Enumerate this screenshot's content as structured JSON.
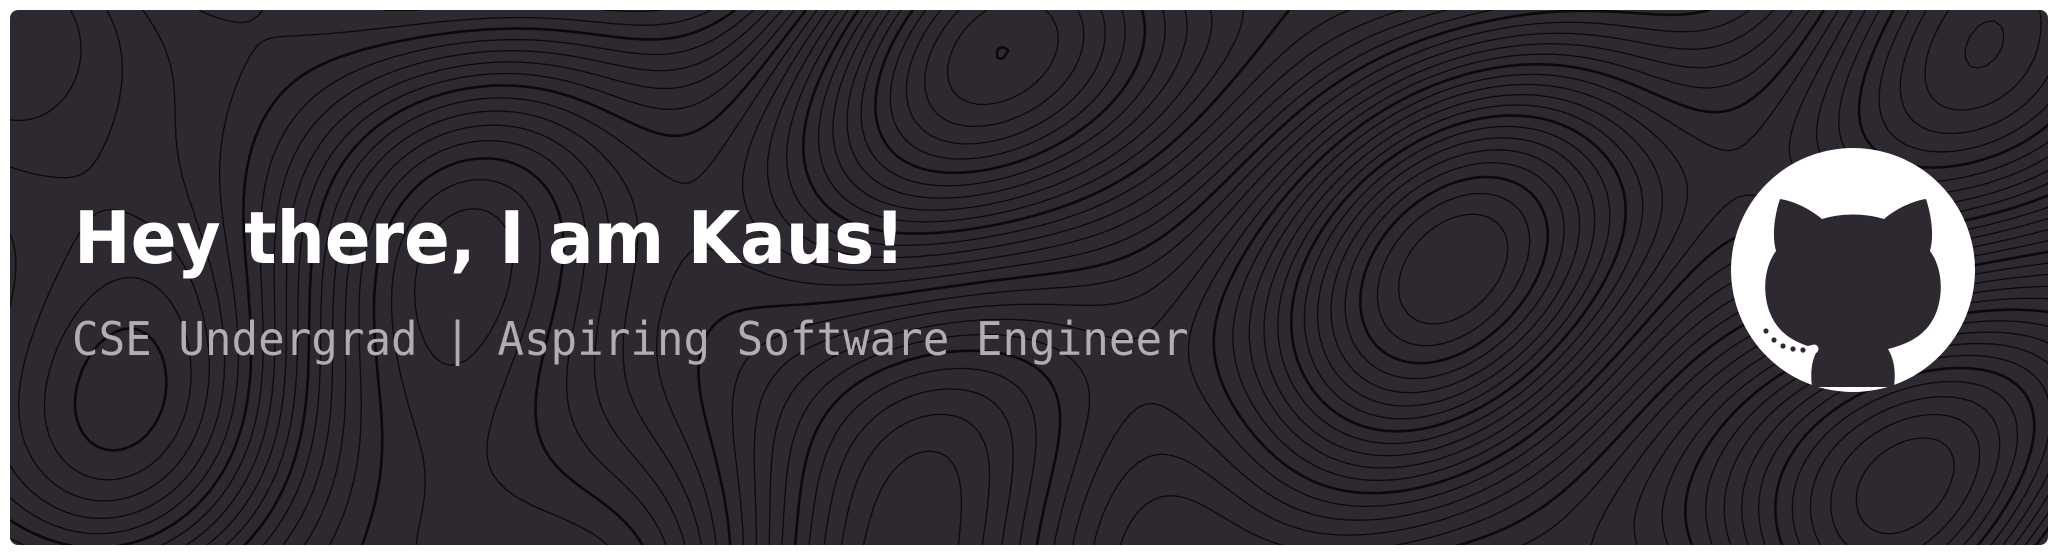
{
  "header": {
    "greeting": "Hey there, I am Kaus!",
    "tagline": "CSE Undergrad | Aspiring Software Engineer"
  },
  "logo": {
    "icon": "github-octocat-icon"
  },
  "colors": {
    "background": "#2e2930",
    "contour_lines": "#0b090c",
    "title": "#ffffff",
    "subtitle": "#b3adb2",
    "logo": "#ffffff"
  }
}
